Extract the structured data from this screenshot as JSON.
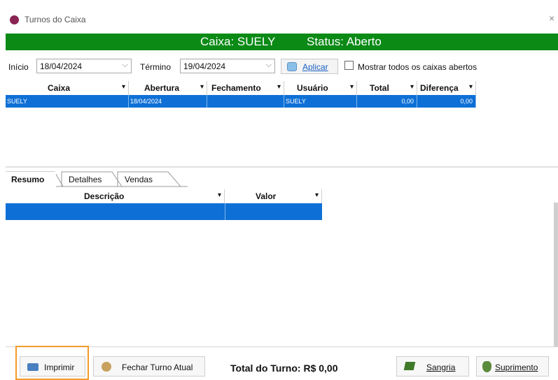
{
  "window": {
    "title": "Turnos do Caixa",
    "close_glyph": "×"
  },
  "banner": {
    "caixa": "Caixa: SUELY",
    "status": "Status: Aberto"
  },
  "filter": {
    "inicio_label": "Início",
    "inicio_value": "18/04/2024",
    "termino_label": "Término",
    "termino_value": "19/04/2024",
    "aplicar_label": "Aplicar",
    "mostrar_label": "Mostrar todos os caixas abertos",
    "mostrar_checked": false
  },
  "shifts_table": {
    "columns": [
      "Caixa",
      "Abertura",
      "Fechamento",
      "Usuário",
      "Total",
      "Diferença"
    ],
    "rows": [
      {
        "caixa": "SUELY",
        "abertura": "18/04/2024",
        "fechamento": "",
        "usuario": "SUELY",
        "total": "0,00",
        "diferenca": "0,00"
      }
    ]
  },
  "tabs": [
    {
      "label": "Resumo",
      "active": true
    },
    {
      "label": "Detalhes",
      "active": false
    },
    {
      "label": "Vendas",
      "active": false
    }
  ],
  "summary_table": {
    "columns": [
      "Descrição",
      "Valor"
    ]
  },
  "footer": {
    "imprimir_label": "Imprimir",
    "fechar_turno_label": "Fechar Turno Atual",
    "total_turno": "Total do Turno: R$ 0,00",
    "sangria_label": "Sangria",
    "suprimento_label": "Suprimento"
  },
  "icons": [
    "app-icon",
    "close-icon",
    "calendar-icon",
    "printer-icon",
    "user-icon",
    "sangria-icon",
    "money-bag-icon",
    "dropdown-arrow-icon"
  ],
  "colors": {
    "banner_bg": "#0b8a16",
    "selection_bg": "#0e70d6",
    "highlight": "#f39a2c",
    "app_icon": "#8a2452"
  }
}
